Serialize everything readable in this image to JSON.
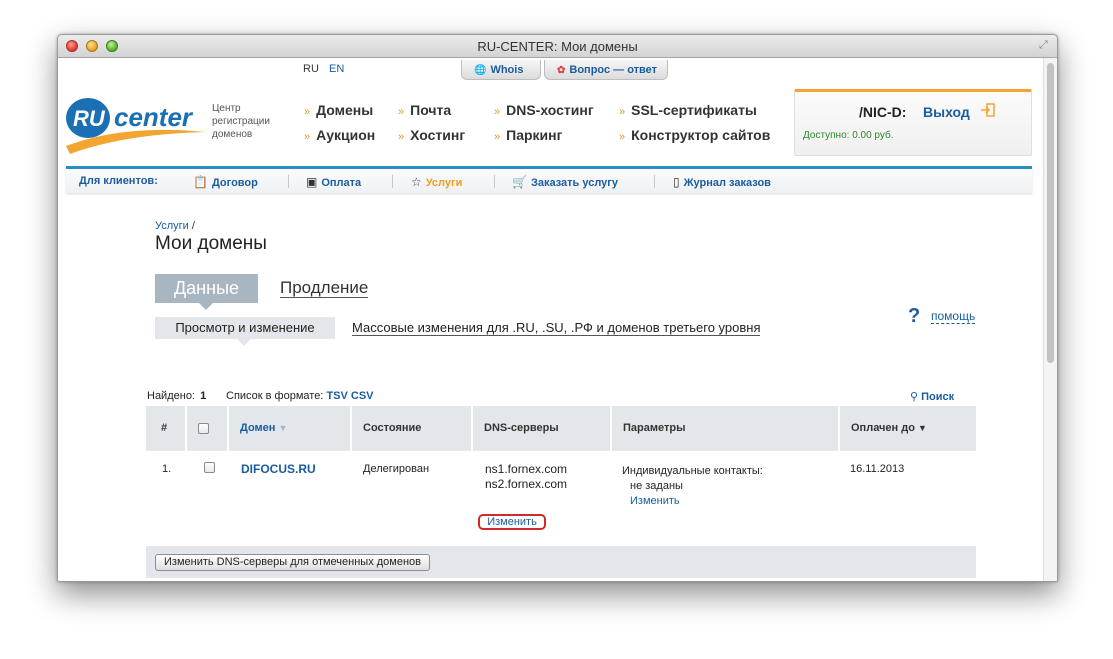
{
  "window": {
    "title": "RU-CENTER: Мои домены"
  },
  "lang": {
    "ru": "RU",
    "en": "EN"
  },
  "top_tabs": [
    {
      "label": "Whois"
    },
    {
      "label": "Вопрос — ответ"
    }
  ],
  "logo": {
    "ru": "RU",
    "center": "center",
    "subtitle_line1": "Центр",
    "subtitle_line2": "регистрации",
    "subtitle_line3": "доменов"
  },
  "nav": {
    "row1": [
      "Домены",
      "Почта",
      "DNS-хостинг",
      "SSL-сертификаты"
    ],
    "row2": [
      "Аукцион",
      "Хостинг",
      "Паркинг",
      "Конструктор сайтов"
    ]
  },
  "user": {
    "nic": "/NIC-D:",
    "logout": "Выход",
    "balance": "Доступно: 0.00 руб."
  },
  "menu": {
    "label": "Для клиентов:",
    "items": [
      {
        "label": "Договор",
        "icon": "clipboard-icon"
      },
      {
        "label": "Оплата",
        "icon": "wallet-icon"
      },
      {
        "label": "Услуги",
        "icon": "star-icon"
      },
      {
        "label": "Заказать услугу",
        "icon": "cart-icon"
      },
      {
        "label": "Журнал заказов",
        "icon": "book-icon"
      }
    ],
    "active_color": "#f29b1e"
  },
  "breadcrumb": {
    "link": "Услуги",
    "sep": "/"
  },
  "page_title": "Мои домены",
  "tabs": {
    "active": "Данные",
    "other": "Продление"
  },
  "subtabs": {
    "active": "Просмотр и изменение",
    "other": "Массовые изменения для .RU, .SU, .РФ и доменов третьего уровня"
  },
  "help": {
    "q": "?",
    "label": "помощь"
  },
  "summary": {
    "found_label": "Найдено:",
    "found_count": "1",
    "format_label": "Список в формате:",
    "tsv": "TSV",
    "csv": "CSV",
    "search": "Поиск"
  },
  "table": {
    "headers": {
      "num": "#",
      "domain": "Домен",
      "state": "Состояние",
      "dns": "DNS-серверы",
      "params": "Параметры",
      "paid": "Оплачен до"
    },
    "rows": [
      {
        "num": "1.",
        "domain": "DIFOCUS.RU",
        "state": "Делегирован",
        "ns1": "ns1.fornex.com",
        "ns2": "ns2.fornex.com",
        "dns_change": "Изменить",
        "params_line1": "Индивидуальные контакты:",
        "params_line2": "не заданы",
        "params_change": "Изменить",
        "paid": "16.11.2013"
      }
    ]
  },
  "footer": {
    "button": "Изменить DNS-серверы для отмеченных доменов"
  },
  "colors": {
    "link": "#1a5c9e",
    "accent": "#f2a630",
    "tab_active": "#a8b6c2",
    "header_bg": "#e3e7eb",
    "highlight": "#d02a2a"
  }
}
